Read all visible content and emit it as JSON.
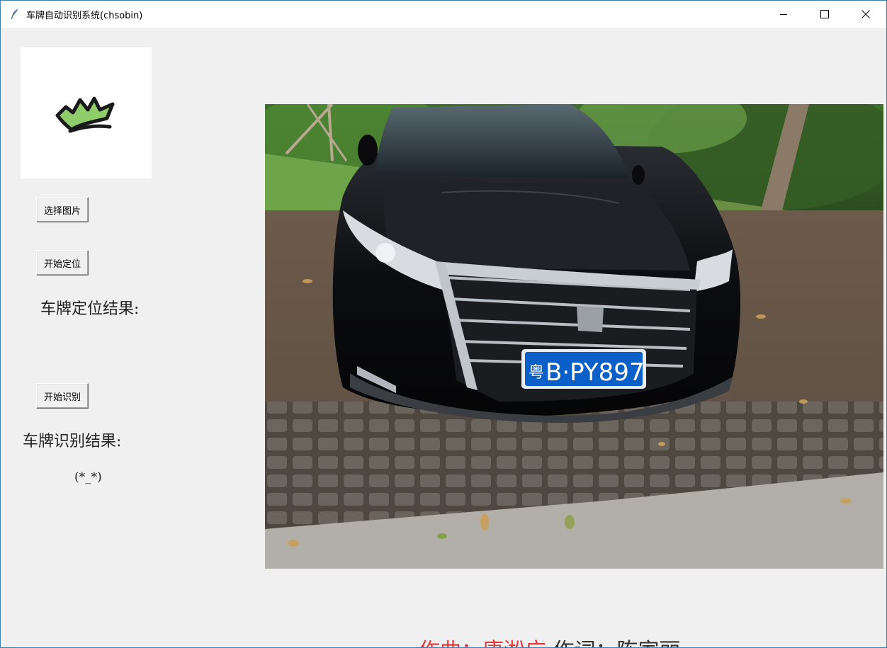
{
  "window": {
    "title": "车牌自动识别系统(chsobin)",
    "app_icon": "feather-icon",
    "controls": [
      "minimize-icon",
      "maximize-icon",
      "close-icon"
    ]
  },
  "sidebar": {
    "logo": "crown-logo",
    "select_image_button": "选择图片",
    "locate_button": "开始定位",
    "locate_result_label": "车牌定位结果:",
    "recognize_button": "开始识别",
    "recognize_result_label": "车牌识别结果:",
    "recognize_result_value": "(*_*)"
  },
  "photo": {
    "plate_province": "粤",
    "plate_number": "B·PY897"
  },
  "footer": {
    "composer": "作曲：康淞广",
    "lyricist": "作词：陈家丽"
  },
  "colors": {
    "title_border": "#3c7fb1",
    "window_bg": "#f0f0f0",
    "footer_red": "#e03a3a",
    "footer_dark": "#333333",
    "plate_blue": "#0a5fc9"
  }
}
